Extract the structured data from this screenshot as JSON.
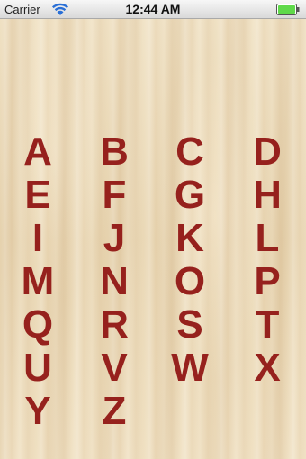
{
  "status_bar": {
    "carrier": "Carrier",
    "time": "12:44 AM",
    "battery_color": "#5fd94a"
  },
  "letter_color": "#96211d",
  "letters": [
    "A",
    "B",
    "C",
    "D",
    "E",
    "F",
    "G",
    "H",
    "I",
    "J",
    "K",
    "L",
    "M",
    "N",
    "O",
    "P",
    "Q",
    "R",
    "S",
    "T",
    "U",
    "V",
    "W",
    "X",
    "Y",
    "Z"
  ]
}
